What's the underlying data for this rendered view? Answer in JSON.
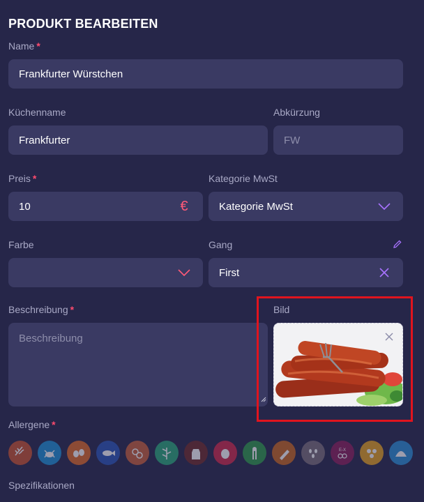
{
  "header": {
    "title": "PRODUKT BEARBEITEN"
  },
  "form": {
    "name": {
      "label": "Name",
      "required": "*",
      "value": "Frankfurter Würstchen"
    },
    "kitchen_name": {
      "label": "Küchenname",
      "value": "Frankfurter"
    },
    "abbreviation": {
      "label": "Abkürzung",
      "placeholder": "FW"
    },
    "price": {
      "label": "Preis",
      "required": "*",
      "value": "10",
      "currency_symbol": "€"
    },
    "vat_category": {
      "label": "Kategorie MwSt",
      "selected": "Kategorie MwSt"
    },
    "color": {
      "label": "Farbe",
      "selected": ""
    },
    "course": {
      "label": "Gang",
      "selected": "First"
    },
    "description": {
      "label": "Beschreibung",
      "required": "*",
      "placeholder": "Beschreibung"
    },
    "image": {
      "label": "Bild"
    },
    "allergens": {
      "label": "Allergene",
      "required": "*",
      "items": [
        {
          "icon": "gluten-icon",
          "color": "#c8532f"
        },
        {
          "icon": "crustaceans-icon",
          "color": "#1e90d6"
        },
        {
          "icon": "eggs-icon",
          "color": "#e06a25"
        },
        {
          "icon": "fish-icon",
          "color": "#2b55b6"
        },
        {
          "icon": "peanuts-icon",
          "color": "#c9603a"
        },
        {
          "icon": "soy-icon",
          "color": "#2aa87a"
        },
        {
          "icon": "milk-icon",
          "color": "#6d2a2a"
        },
        {
          "icon": "nuts-icon",
          "color": "#d0284a"
        },
        {
          "icon": "celery-icon",
          "color": "#2f9a4a"
        },
        {
          "icon": "mustard-icon",
          "color": "#c8661e"
        },
        {
          "icon": "sesame-icon",
          "color": "#7a6e7a"
        },
        {
          "icon": "sulphites-icon",
          "color": "#8a1e5a",
          "text": "E-X"
        },
        {
          "icon": "lupin-icon",
          "color": "#e8a21e"
        },
        {
          "icon": "molluscs-icon",
          "color": "#2a8ed6"
        }
      ]
    },
    "specifications": {
      "label": "Spezifikationen"
    }
  },
  "colors": {
    "background": "#262649",
    "field": "#3a3a63",
    "accent": "#a873ff",
    "required": "#ff4b6e",
    "highlight": "#e0141e"
  }
}
